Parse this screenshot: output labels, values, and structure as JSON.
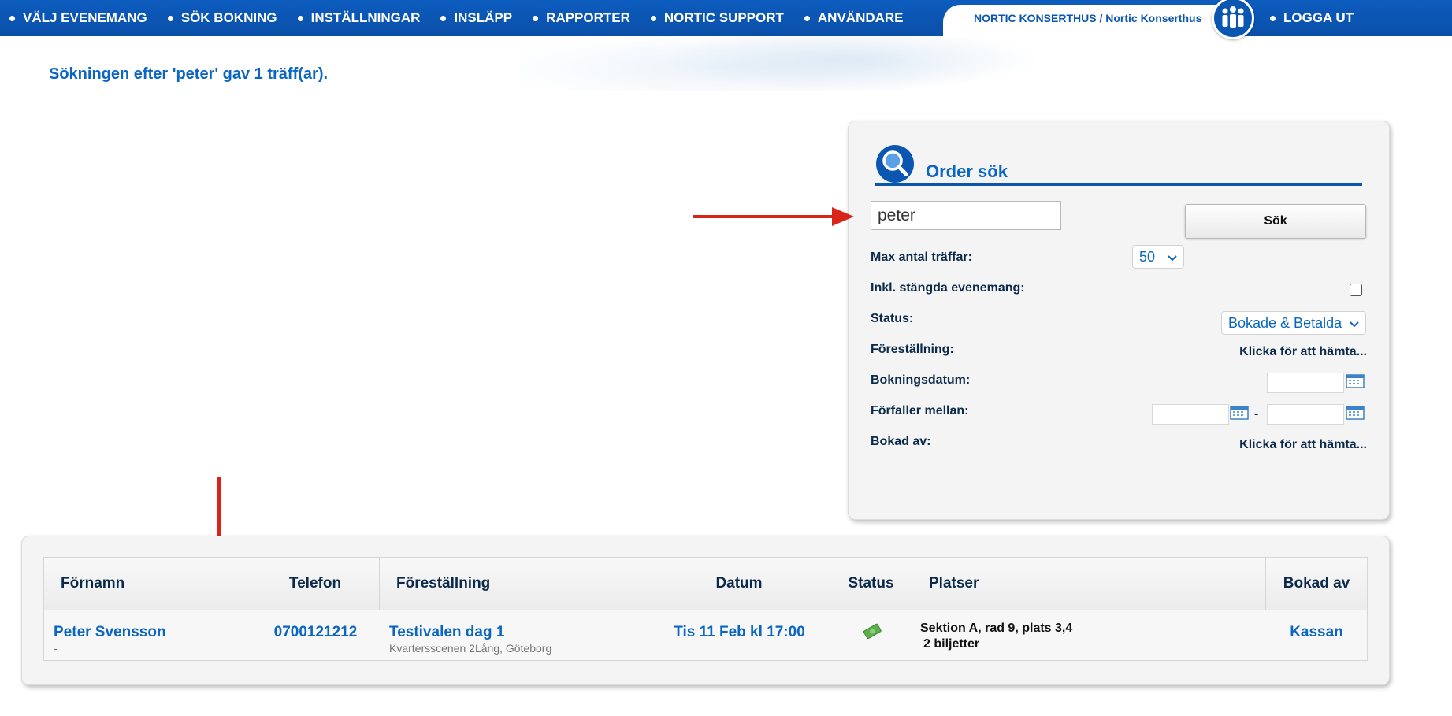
{
  "nav": {
    "items": [
      "VÄLJ EVENEMANG",
      "SÖK BOKNING",
      "INSTÄLLNINGAR",
      "INSLÄPP",
      "RAPPORTER",
      "NORTIC SUPPORT",
      "ANVÄNDARE"
    ],
    "org": "NORTIC KONSERTHUS / Nortic Konserthus",
    "logout": "LOGGA UT"
  },
  "search_result_message": "Sökningen efter 'peter' gav 1 träff(ar).",
  "order_search": {
    "title": "Order sök",
    "query_value": "peter",
    "search_button": "Sök",
    "max_hits_label": "Max antal träffar:",
    "max_hits_value": "50",
    "include_closed_label": "Inkl. stängda evenemang:",
    "include_closed_checked": false,
    "status_label": "Status:",
    "status_value": "Bokade & Betalda",
    "performance_label": "Föreställning:",
    "performance_link": "Klicka för att hämta...",
    "booking_date_label": "Bokningsdatum:",
    "expires_label": "Förfaller mellan:",
    "expires_separator": "-",
    "booked_by_label": "Bokad av:",
    "booked_by_link": "Klicka för att hämta..."
  },
  "results": {
    "columns": [
      "Förnamn",
      "Telefon",
      "Föreställning",
      "Datum",
      "Status",
      "Platser",
      "Bokad av"
    ],
    "rows": [
      {
        "name": "Peter Svensson",
        "name_sub": "-",
        "phone": "0700121212",
        "performance": "Testivalen dag 1",
        "venue": "Kvartersscenen 2Lång, Göteborg",
        "date": "Tis 11 Feb kl 17:00",
        "status_icon": "paid-money-icon",
        "seats": "Sektion A, rad 9, plats 3,4",
        "tickets": "2 biljetter",
        "booked_by": "Kassan"
      }
    ]
  },
  "colors": {
    "nav_blue": "#0a56b0",
    "link_blue": "#0a66c2",
    "arrow_red": "#d9241a"
  }
}
